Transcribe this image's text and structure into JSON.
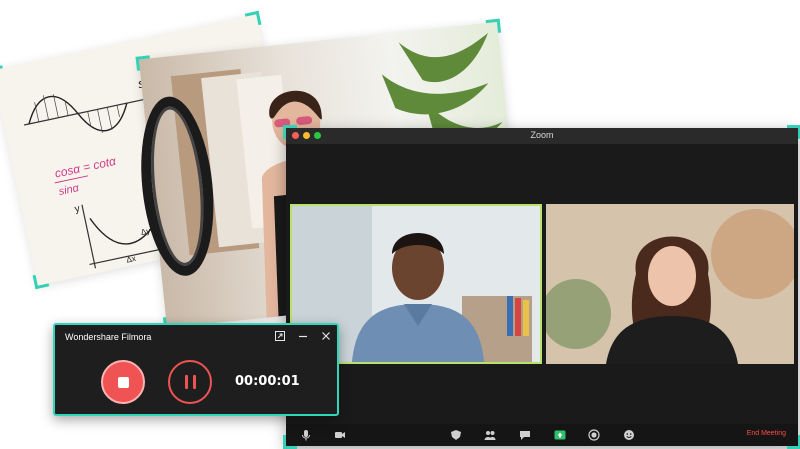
{
  "zoom": {
    "title": "Zoom",
    "toolbar": {
      "end_meeting_label": "End Meeting",
      "icons": [
        "mic-icon",
        "camera-icon",
        "security-icon",
        "participants-icon",
        "chat-icon",
        "share-screen-icon",
        "record-icon",
        "reactions-icon"
      ]
    }
  },
  "recorder": {
    "title": "Wondershare Filmora",
    "timer": "00:00:01",
    "accent_color": "#ef5353",
    "frame_color": "#2fd6b9"
  },
  "notebook": {
    "formula_sin": "sinα",
    "formula_cos_line1": "cosα = cotα",
    "formula_cos_line2": "sinα",
    "label_y": "y",
    "label_dx": "Δx",
    "label_dy": "Δy"
  },
  "colors": {
    "highlight_corner": "#35d0b5",
    "speaker_border": "#b7e36a",
    "end_meeting": "#ff4a4a"
  }
}
